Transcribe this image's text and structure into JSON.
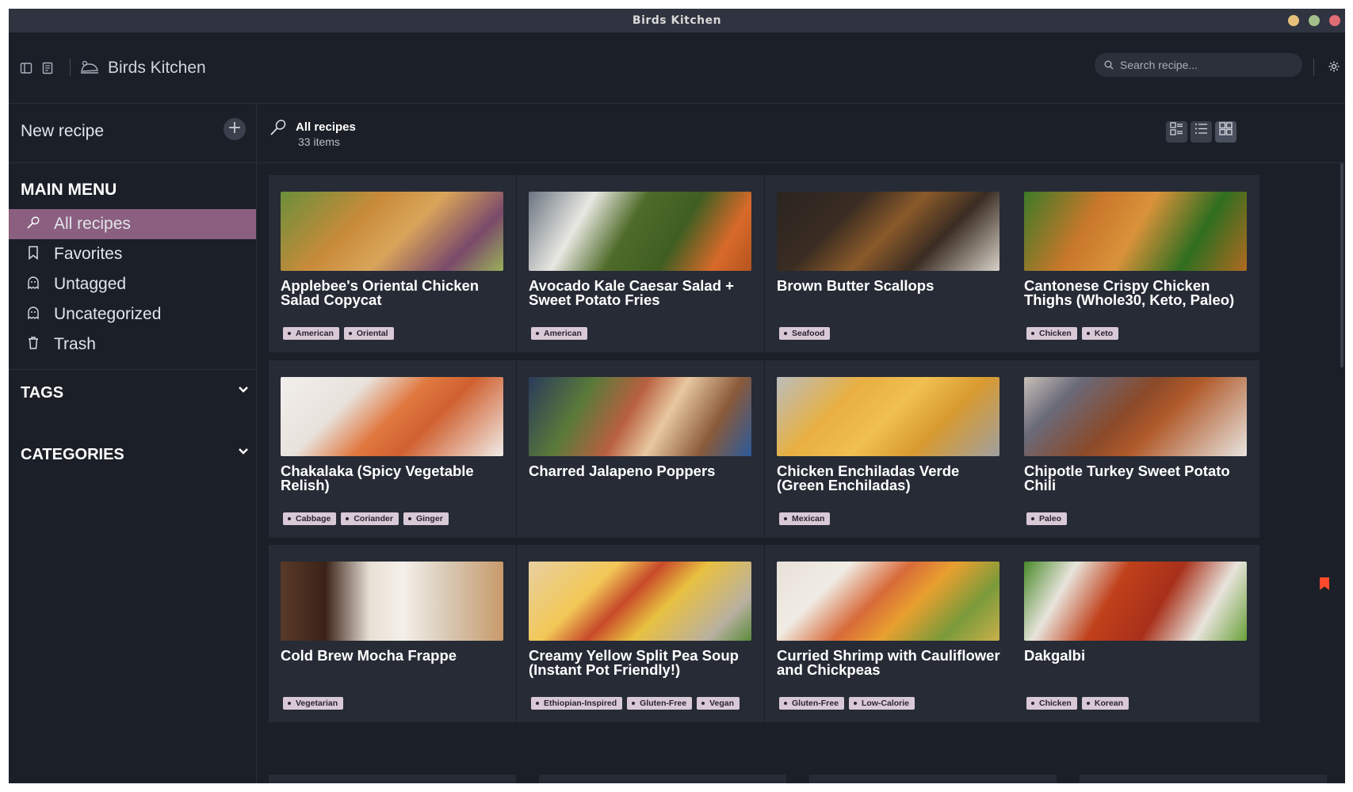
{
  "window": {
    "title": "Birds Kitchen"
  },
  "header": {
    "app_title": "Birds Kitchen",
    "search_placeholder": "Search recipe...",
    "icons": [
      "sidebar-toggle-icon",
      "book-icon",
      "cooking-bird-icon",
      "search-icon",
      "gear-icon"
    ]
  },
  "sidebar": {
    "new_recipe_label": "New recipe",
    "main_menu_title": "MAIN MENU",
    "items": [
      {
        "label": "All recipes",
        "icon": "whisk-icon",
        "active": true
      },
      {
        "label": "Favorites",
        "icon": "bookmark-icon",
        "active": false
      },
      {
        "label": "Untagged",
        "icon": "ghost-icon",
        "active": false
      },
      {
        "label": "Uncategorized",
        "icon": "ghost-icon",
        "active": false
      },
      {
        "label": "Trash",
        "icon": "trash-icon",
        "active": false
      }
    ],
    "tags_title": "TAGS",
    "categories_title": "CATEGORIES"
  },
  "main": {
    "title": "All recipes",
    "count": "33 items",
    "view_modes": [
      "grid-list-view",
      "list-view",
      "grid-view"
    ]
  },
  "recipes": [
    {
      "title": "Applebee's Oriental Chicken Salad Copycat",
      "tags": [
        "American",
        "Oriental"
      ]
    },
    {
      "title": "Avocado Kale Caesar Salad + Sweet Potato Fries",
      "tags": [
        "American"
      ]
    },
    {
      "title": "Brown Butter Scallops",
      "tags": [
        "Seafood"
      ]
    },
    {
      "title": "Cantonese Crispy Chicken Thighs (Whole30, Keto, Paleo)",
      "tags": [
        "Chicken",
        "Keto"
      ]
    },
    {
      "title": "Chakalaka (Spicy Vegetable Relish)",
      "tags": [
        "Cabbage",
        "Coriander",
        "Ginger"
      ]
    },
    {
      "title": "Charred Jalapeno Poppers",
      "tags": []
    },
    {
      "title": "Chicken Enchiladas Verde (Green Enchiladas)",
      "tags": [
        "Mexican"
      ]
    },
    {
      "title": "Chipotle Turkey Sweet Potato Chili",
      "tags": [
        "Paleo"
      ]
    },
    {
      "title": "Cold Brew Mocha Frappe",
      "tags": [
        "Vegetarian"
      ]
    },
    {
      "title": "Creamy Yellow Split Pea Soup (Instant Pot Friendly!)",
      "tags": [
        "Ethiopian-Inspired",
        "Gluten-Free",
        "Vegan"
      ]
    },
    {
      "title": "Curried Shrimp with Cauliflower and Chickpeas",
      "tags": [
        "Gluten-Free",
        "Low-Calorie"
      ]
    },
    {
      "title": "Dakgalbi",
      "tags": [
        "Chicken",
        "Korean"
      ],
      "favorite": true
    }
  ],
  "colors": {
    "background": "#1b1f27",
    "card": "#262b36",
    "active_menu": "#8a5f7f",
    "tag_bg": "#d9c9d6",
    "favorite_marker": "#ff4b2b"
  }
}
